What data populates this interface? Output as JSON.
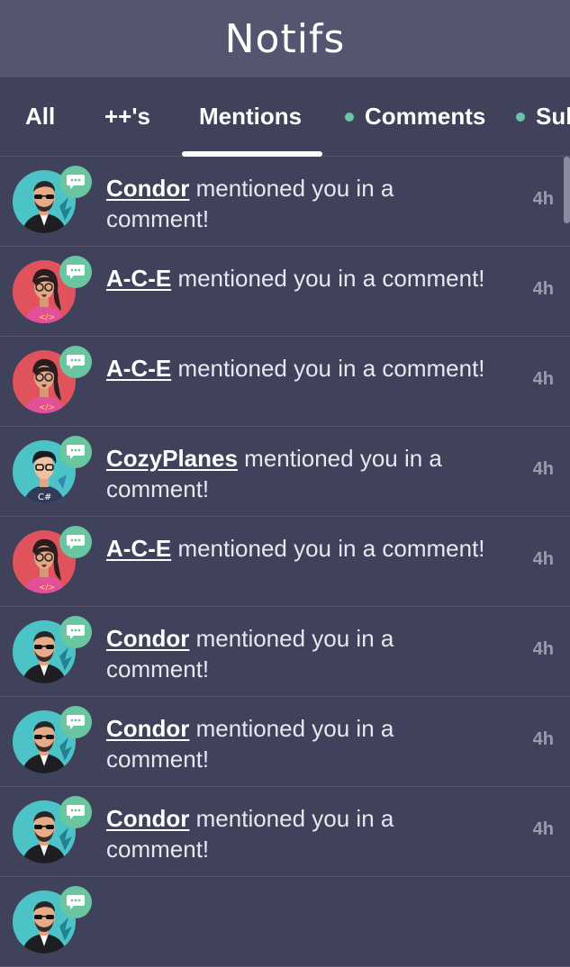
{
  "header": {
    "title": "Notifs"
  },
  "tabs": [
    {
      "label": "All",
      "dot": false,
      "active": false
    },
    {
      "label": "++'s",
      "dot": false,
      "active": false
    },
    {
      "label": "Mentions",
      "dot": false,
      "active": true
    },
    {
      "label": "Comments",
      "dot": true,
      "active": false
    },
    {
      "label": "Sub",
      "dot": true,
      "active": false
    }
  ],
  "colors": {
    "background": "#40415a",
    "header_bg": "#545670",
    "accent": "#69c6a1",
    "time_text": "#9a9bad"
  },
  "notifications": [
    {
      "user": "Condor",
      "avatar": "condor-avatar",
      "message": " mentioned you in a comment!",
      "time": "4h"
    },
    {
      "user": "A-C-E",
      "avatar": "ace-avatar",
      "message": " mentioned you in a comment!",
      "time": "4h"
    },
    {
      "user": "A-C-E",
      "avatar": "ace-avatar",
      "message": " mentioned you in a comment!",
      "time": "4h"
    },
    {
      "user": "CozyPlanes",
      "avatar": "cozyplanes-avatar",
      "message": " mentioned you in a comment!",
      "time": "4h"
    },
    {
      "user": "A-C-E",
      "avatar": "ace-avatar",
      "message": " mentioned you in a comment!",
      "time": "4h"
    },
    {
      "user": "Condor",
      "avatar": "condor-avatar",
      "message": " mentioned you in a comment!",
      "time": "4h"
    },
    {
      "user": "Condor",
      "avatar": "condor-avatar",
      "message": " mentioned you in a comment!",
      "time": "4h"
    },
    {
      "user": "Condor",
      "avatar": "condor-avatar",
      "message": " mentioned you in a comment!",
      "time": "4h"
    },
    {
      "user": "",
      "avatar": "condor-avatar",
      "message": "",
      "time": ""
    }
  ]
}
